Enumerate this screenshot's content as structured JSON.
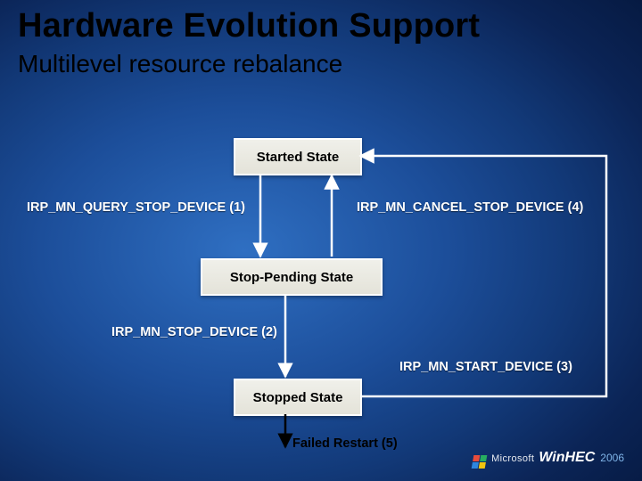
{
  "title": "Hardware Evolution Support",
  "subtitle": "Multilevel resource rebalance",
  "states": {
    "started": "Started State",
    "pending": "Stop-Pending State",
    "stopped": "Stopped State"
  },
  "transitions": {
    "query_stop": "IRP_MN_QUERY_STOP_DEVICE (1)",
    "stop_device": "IRP_MN_STOP_DEVICE (2)",
    "start_device": "IRP_MN_START_DEVICE (3)",
    "cancel_stop": "IRP_MN_CANCEL_STOP_DEVICE (4)",
    "failed_restart": "Failed Restart (5)"
  },
  "branding": {
    "vendor_small": "Microsoft",
    "product": "WinHEC",
    "year": "2006"
  },
  "colors": {
    "bg_center": "#2f6fc2",
    "bg_edge": "#061a42",
    "box_border": "#ffffff",
    "box_fill": "#e8e7df",
    "arrow": "#ffffff"
  }
}
